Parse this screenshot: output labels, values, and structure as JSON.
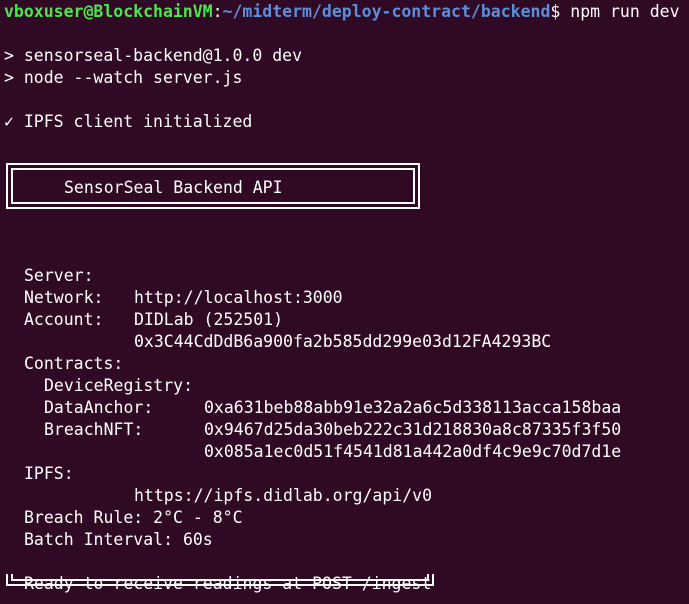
{
  "prompt": {
    "user_host": "vboxuser@BlockchainVM",
    "sep": ":",
    "path": "~/midterm/deploy-contract/backend",
    "symbol": "$",
    "command": " npm run dev"
  },
  "npm_output": {
    "line1": "> sensorseal-backend@1.0.0 dev",
    "line2": "> node --watch server.js"
  },
  "ipfs_init": "✓ IPFS client initialized",
  "banner_title": "SensorSeal Backend API",
  "info": {
    "server_label": "Server:",
    "server_value": "http://localhost:3000",
    "network_label": "Network:",
    "network_value": "DIDLab (252501)",
    "account_label": "Account:",
    "account_value": "0x3C44CdDdB6a900fa2b585dd299e03d12FA4293BC"
  },
  "contracts": {
    "heading": "Contracts:",
    "items": [
      {
        "name": "DeviceRegistry:",
        "address": "0xa631beb88abb91e32a2a6c5d338113acca158baa"
      },
      {
        "name": "DataAnchor:",
        "address": "0x9467d25da30beb222c31d218830a8c87335f3f50"
      },
      {
        "name": "BreachNFT:",
        "address": "0x085a1ec0d51f4541d81a442a0df4c9e9c70d7d1e"
      }
    ]
  },
  "ipfs": {
    "label": "IPFS:",
    "value": "https://ipfs.didlab.org/api/v0"
  },
  "rules": {
    "breach_rule": "Breach Rule: 2°C - 8°C",
    "batch_interval": "Batch Interval: 60s"
  },
  "ready": "Ready to receive readings at POST /ingest",
  "colors": {
    "background": "#300a24",
    "user_host": "#4ee44e",
    "path": "#5b8fdb",
    "text": "#ffffff"
  }
}
